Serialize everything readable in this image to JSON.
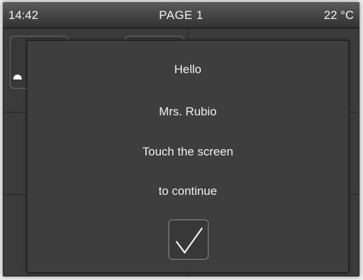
{
  "status_bar": {
    "time": "14:42",
    "page_title": "PAGE 1",
    "temperature": "22 °C"
  },
  "dialog": {
    "greeting": "Hello",
    "user_name": "Mrs. Rubio",
    "instruction_line1": "Touch the screen",
    "instruction_line2": "to continue",
    "confirm_icon": "checkmark-icon"
  },
  "colors": {
    "background": "#2a2a2a",
    "dialog": "#3e3e3e",
    "text": "#f0f0f0"
  }
}
